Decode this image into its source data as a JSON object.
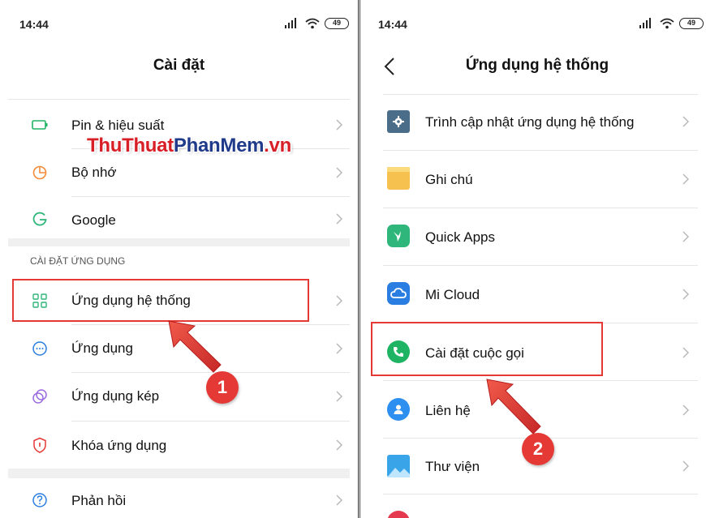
{
  "left": {
    "status": {
      "time": "14:44",
      "battery": "49"
    },
    "title": "Cài đặt",
    "watermark": {
      "part1": "ThuThuat",
      "part2": "PhanMem",
      "part3": ".vn"
    },
    "items": [
      {
        "label": "Pin & hiệu suất",
        "icon": "battery-icon"
      },
      {
        "label": "Bộ nhớ",
        "icon": "storage-pie-icon"
      },
      {
        "label": "Google",
        "icon": "google-g-icon"
      },
      {
        "label": "Ứng dụng hệ thống",
        "icon": "grid-apps-icon"
      },
      {
        "label": "Ứng dụng",
        "icon": "dots-circle-icon"
      },
      {
        "label": "Ứng dụng kép",
        "icon": "dual-circles-icon"
      },
      {
        "label": "Khóa ứng dụng",
        "icon": "shield-lock-icon"
      },
      {
        "label": "Phản hồi",
        "icon": "question-circle-icon"
      }
    ],
    "section_header": "CÀI ĐẶT ỨNG DỤNG",
    "callout_number": "1"
  },
  "right": {
    "status": {
      "time": "14:44",
      "battery": "49"
    },
    "title": "Ứng dụng hệ thống",
    "items": [
      {
        "label": "Trình cập nhật ứng dụng hệ thống",
        "icon": "gear-icon",
        "color": "#4a6e8a"
      },
      {
        "label": "Ghi chú",
        "icon": "notes-icon",
        "color": "#f7c14f"
      },
      {
        "label": "Quick Apps",
        "icon": "hummingbird-icon",
        "color": "#2fb67a"
      },
      {
        "label": "Mi Cloud",
        "icon": "cloud-icon",
        "color": "#2a7de1"
      },
      {
        "label": "Cài đặt cuộc gọi",
        "icon": "phone-icon",
        "color": "#1fb463"
      },
      {
        "label": "Liên hệ",
        "icon": "contact-icon",
        "color": "#2d8ff0"
      },
      {
        "label": "Thư viện",
        "icon": "gallery-icon",
        "color": "#3aa4e8"
      }
    ],
    "callout_number": "2"
  },
  "colors": {
    "highlight": "#e53935",
    "accent_green": "#1fb463"
  }
}
